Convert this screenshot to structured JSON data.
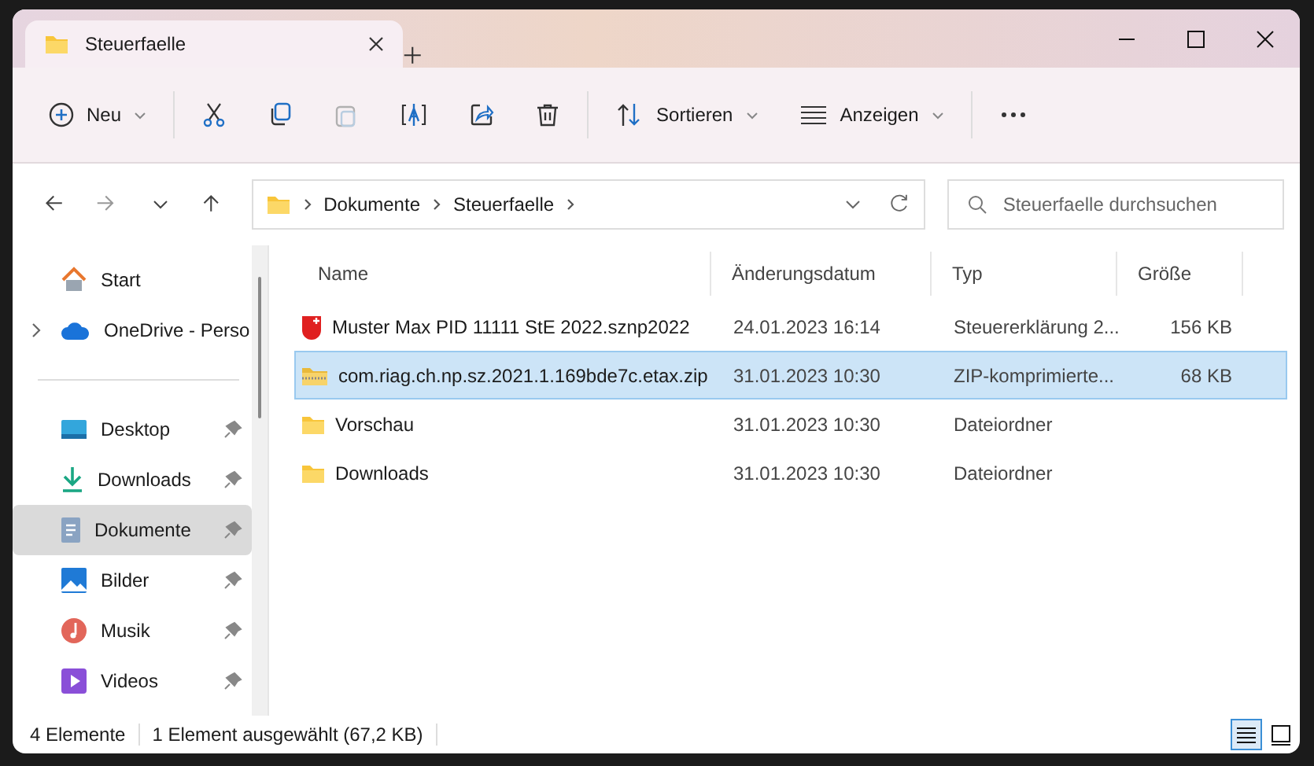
{
  "tab": {
    "title": "Steuerfaelle"
  },
  "toolbar": [
    {
      "kind": "new",
      "label": "Neu",
      "disabled": false
    },
    {
      "kind": "cut",
      "disabled": false
    },
    {
      "kind": "copy",
      "disabled": false
    },
    {
      "kind": "paste",
      "disabled": true
    },
    {
      "kind": "rename",
      "disabled": false
    },
    {
      "kind": "share",
      "disabled": false
    },
    {
      "kind": "delete",
      "disabled": false
    },
    {
      "kind": "sort",
      "label": "Sortieren",
      "disabled": false
    },
    {
      "kind": "view",
      "label": "Anzeigen",
      "disabled": false
    },
    {
      "kind": "more",
      "disabled": false
    }
  ],
  "breadcrumb": [
    "Dokumente",
    "Steuerfaelle"
  ],
  "search": {
    "placeholder": "Steuerfaelle durchsuchen"
  },
  "sidebar": {
    "items": [
      {
        "kind": "home",
        "label": "Start",
        "pinned": false,
        "expandable": false,
        "selected": false
      },
      {
        "kind": "cloud",
        "label": "OneDrive - Perso",
        "pinned": false,
        "expandable": true,
        "selected": false
      },
      {
        "kind": "divider"
      },
      {
        "kind": "desktop",
        "label": "Desktop",
        "pinned": true,
        "expandable": false,
        "selected": false
      },
      {
        "kind": "downloads",
        "label": "Downloads",
        "pinned": true,
        "expandable": false,
        "selected": false
      },
      {
        "kind": "documents",
        "label": "Dokumente",
        "pinned": true,
        "expandable": false,
        "selected": true
      },
      {
        "kind": "pictures",
        "label": "Bilder",
        "pinned": true,
        "expandable": false,
        "selected": false
      },
      {
        "kind": "music",
        "label": "Musik",
        "pinned": true,
        "expandable": false,
        "selected": false
      },
      {
        "kind": "videos",
        "label": "Videos",
        "pinned": true,
        "expandable": false,
        "selected": false
      }
    ]
  },
  "table": {
    "columns": [
      "Name",
      "Änderungsdatum",
      "Typ",
      "Größe"
    ],
    "rows": [
      {
        "kind": "tax-file",
        "name": "Muster Max PID 11111 StE 2022.sznp2022",
        "date": "24.01.2023 16:14",
        "type": "Steuererklärung 2...",
        "size": "156 KB",
        "selected": false
      },
      {
        "kind": "zip",
        "name": "com.riag.ch.np.sz.2021.1.169bde7c.etax.zip",
        "date": "31.01.2023 10:30",
        "type": "ZIP-komprimierte...",
        "size": "68 KB",
        "selected": true
      },
      {
        "kind": "folder",
        "name": "Vorschau",
        "date": "31.01.2023 10:30",
        "type": "Dateiordner",
        "selected": false
      },
      {
        "kind": "folder",
        "name": "Downloads",
        "date": "31.01.2023 10:30",
        "type": "Dateiordner",
        "selected": false
      }
    ]
  },
  "status_bar": {
    "count": "4 Elemente",
    "selection": "1 Element ausgewählt (67,2 KB)"
  },
  "view_modes": [
    {
      "kind": "details",
      "selected": true
    },
    {
      "kind": "tiles",
      "selected": false
    }
  ]
}
